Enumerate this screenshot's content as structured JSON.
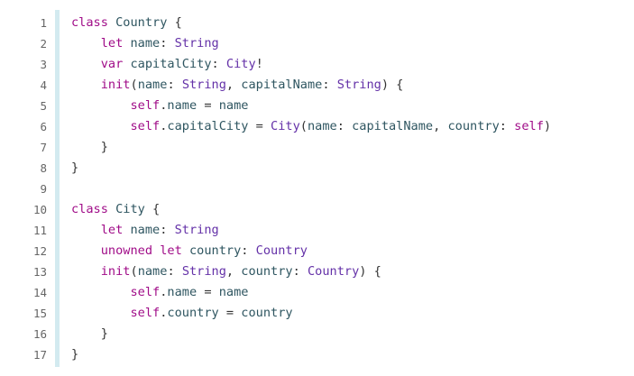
{
  "colors": {
    "keyword": "#a00c88",
    "type": "#6431a8",
    "identifier": "#2e5560",
    "plain": "#333333",
    "line_number": "#666666",
    "gutter_bar": "#d3eaf0",
    "background": "#ffffff"
  },
  "code": {
    "lines": [
      {
        "n": "1",
        "tokens": [
          [
            "kw",
            "class"
          ],
          [
            "pl",
            " "
          ],
          [
            "id",
            "Country"
          ],
          [
            "pl",
            " {"
          ]
        ]
      },
      {
        "n": "2",
        "tokens": [
          [
            "pl",
            "    "
          ],
          [
            "kw",
            "let"
          ],
          [
            "pl",
            " "
          ],
          [
            "id",
            "name"
          ],
          [
            "pl",
            ": "
          ],
          [
            "ty",
            "String"
          ]
        ]
      },
      {
        "n": "3",
        "tokens": [
          [
            "pl",
            "    "
          ],
          [
            "kw",
            "var"
          ],
          [
            "pl",
            " "
          ],
          [
            "id",
            "capitalCity"
          ],
          [
            "pl",
            ": "
          ],
          [
            "ty",
            "City"
          ],
          [
            "pl",
            "!"
          ]
        ]
      },
      {
        "n": "4",
        "tokens": [
          [
            "pl",
            "    "
          ],
          [
            "kw",
            "init"
          ],
          [
            "pl",
            "("
          ],
          [
            "id",
            "name"
          ],
          [
            "pl",
            ": "
          ],
          [
            "ty",
            "String"
          ],
          [
            "pl",
            ", "
          ],
          [
            "id",
            "capitalName"
          ],
          [
            "pl",
            ": "
          ],
          [
            "ty",
            "String"
          ],
          [
            "pl",
            ") {"
          ]
        ]
      },
      {
        "n": "5",
        "tokens": [
          [
            "pl",
            "        "
          ],
          [
            "kw",
            "self"
          ],
          [
            "pl",
            "."
          ],
          [
            "id",
            "name"
          ],
          [
            "pl",
            " = "
          ],
          [
            "id",
            "name"
          ]
        ]
      },
      {
        "n": "6",
        "tokens": [
          [
            "pl",
            "        "
          ],
          [
            "kw",
            "self"
          ],
          [
            "pl",
            "."
          ],
          [
            "id",
            "capitalCity"
          ],
          [
            "pl",
            " = "
          ],
          [
            "ty",
            "City"
          ],
          [
            "pl",
            "("
          ],
          [
            "id",
            "name"
          ],
          [
            "pl",
            ": "
          ],
          [
            "id",
            "capitalName"
          ],
          [
            "pl",
            ", "
          ],
          [
            "id",
            "country"
          ],
          [
            "pl",
            ": "
          ],
          [
            "kw",
            "self"
          ],
          [
            "pl",
            ")"
          ]
        ]
      },
      {
        "n": "7",
        "tokens": [
          [
            "pl",
            "    }"
          ]
        ]
      },
      {
        "n": "8",
        "tokens": [
          [
            "pl",
            "}"
          ]
        ]
      },
      {
        "n": "9",
        "tokens": []
      },
      {
        "n": "10",
        "tokens": [
          [
            "kw",
            "class"
          ],
          [
            "pl",
            " "
          ],
          [
            "id",
            "City"
          ],
          [
            "pl",
            " {"
          ]
        ]
      },
      {
        "n": "11",
        "tokens": [
          [
            "pl",
            "    "
          ],
          [
            "kw",
            "let"
          ],
          [
            "pl",
            " "
          ],
          [
            "id",
            "name"
          ],
          [
            "pl",
            ": "
          ],
          [
            "ty",
            "String"
          ]
        ]
      },
      {
        "n": "12",
        "tokens": [
          [
            "pl",
            "    "
          ],
          [
            "kw",
            "unowned"
          ],
          [
            "pl",
            " "
          ],
          [
            "kw",
            "let"
          ],
          [
            "pl",
            " "
          ],
          [
            "id",
            "country"
          ],
          [
            "pl",
            ": "
          ],
          [
            "ty",
            "Country"
          ]
        ]
      },
      {
        "n": "13",
        "tokens": [
          [
            "pl",
            "    "
          ],
          [
            "kw",
            "init"
          ],
          [
            "pl",
            "("
          ],
          [
            "id",
            "name"
          ],
          [
            "pl",
            ": "
          ],
          [
            "ty",
            "String"
          ],
          [
            "pl",
            ", "
          ],
          [
            "id",
            "country"
          ],
          [
            "pl",
            ": "
          ],
          [
            "ty",
            "Country"
          ],
          [
            "pl",
            ") {"
          ]
        ]
      },
      {
        "n": "14",
        "tokens": [
          [
            "pl",
            "        "
          ],
          [
            "kw",
            "self"
          ],
          [
            "pl",
            "."
          ],
          [
            "id",
            "name"
          ],
          [
            "pl",
            " = "
          ],
          [
            "id",
            "name"
          ]
        ]
      },
      {
        "n": "15",
        "tokens": [
          [
            "pl",
            "        "
          ],
          [
            "kw",
            "self"
          ],
          [
            "pl",
            "."
          ],
          [
            "id",
            "country"
          ],
          [
            "pl",
            " = "
          ],
          [
            "id",
            "country"
          ]
        ]
      },
      {
        "n": "16",
        "tokens": [
          [
            "pl",
            "    }"
          ]
        ]
      },
      {
        "n": "17",
        "tokens": [
          [
            "pl",
            "}"
          ]
        ]
      }
    ]
  }
}
